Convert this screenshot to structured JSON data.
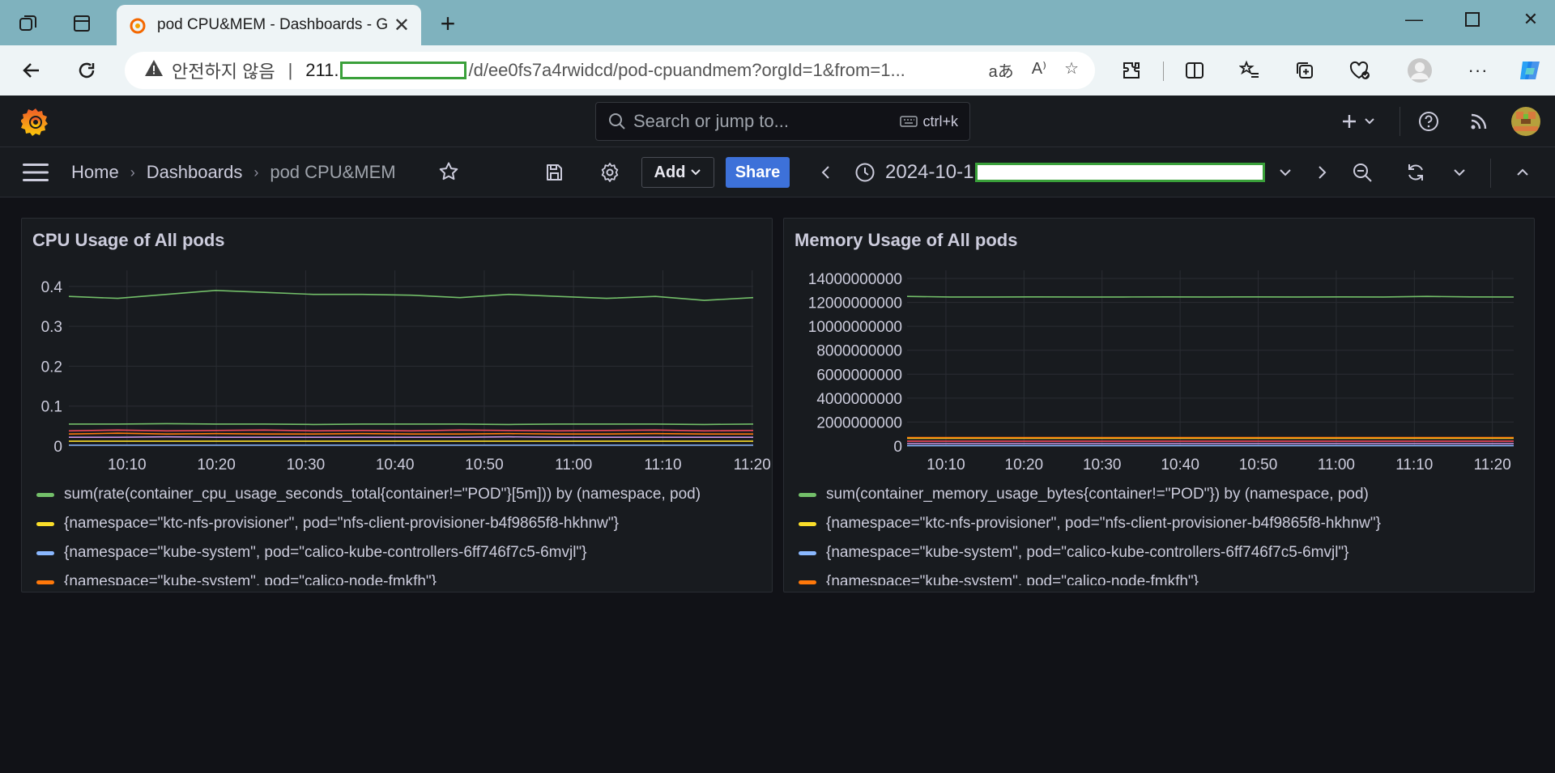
{
  "browser": {
    "tab_title": "pod CPU&MEM - Dashboards - G",
    "address_prefix_notsecure": "안전하지 않음",
    "address_host_prefix": "211.",
    "address_path": "/d/ee0fs7a4rwidcd/pod-cpuandmem?orgId=1&from=1...",
    "read_aloud_label": "aあ"
  },
  "grafana": {
    "search_placeholder": "Search or jump to...",
    "search_shortcut": "ctrl+k",
    "breadcrumbs": [
      "Home",
      "Dashboards",
      "pod CPU&MEM"
    ],
    "add_label": "Add",
    "share_label": "Share",
    "time_range_prefix": "2024-10-1"
  },
  "colors": {
    "green": "#73bf69",
    "yellow": "#fade2a",
    "blue": "#8ab8ff",
    "orange": "#ff780a",
    "red": "#f2495c",
    "purple": "#ca95e5"
  },
  "panels": [
    {
      "title": "CPU Usage of All pods",
      "legend": [
        {
          "color": "#73bf69",
          "text": "sum(rate(container_cpu_usage_seconds_total{container!=\"POD\"}[5m])) by (namespace, pod)"
        },
        {
          "color": "#fade2a",
          "text": "{namespace=\"ktc-nfs-provisioner\", pod=\"nfs-client-provisioner-b4f9865f8-hkhnw\"}"
        },
        {
          "color": "#8ab8ff",
          "text": "{namespace=\"kube-system\", pod=\"calico-kube-controllers-6ff746f7c5-6mvjl\"}"
        },
        {
          "color": "#ff780a",
          "text": "{namespace=\"kube-system\", pod=\"calico-node-fmkfh\"}"
        }
      ]
    },
    {
      "title": "Memory Usage of All pods",
      "legend": [
        {
          "color": "#73bf69",
          "text": "sum(container_memory_usage_bytes{container!=\"POD\"}) by (namespace, pod)"
        },
        {
          "color": "#fade2a",
          "text": "{namespace=\"ktc-nfs-provisioner\", pod=\"nfs-client-provisioner-b4f9865f8-hkhnw\"}"
        },
        {
          "color": "#8ab8ff",
          "text": "{namespace=\"kube-system\", pod=\"calico-kube-controllers-6ff746f7c5-6mvjl\"}"
        },
        {
          "color": "#ff780a",
          "text": "{namespace=\"kube-system\", pod=\"calico-node-fmkfh\"}"
        }
      ]
    }
  ],
  "chart_data": [
    {
      "type": "line",
      "title": "CPU Usage of All pods",
      "x": [
        "10:10",
        "10:20",
        "10:30",
        "10:40",
        "10:50",
        "11:00",
        "11:10",
        "11:20"
      ],
      "yticks": [
        "0",
        "0.1",
        "0.2",
        "0.3",
        "0.4"
      ],
      "ylim": [
        0,
        0.42
      ],
      "series": [
        {
          "name": "sum(rate(container_cpu_usage_seconds_total{container!=\"POD\"}[5m])) by (namespace, pod)",
          "color": "#73bf69",
          "values": [
            0.375,
            0.37,
            0.38,
            0.39,
            0.385,
            0.38,
            0.38,
            0.378,
            0.372,
            0.38,
            0.375,
            0.37,
            0.375,
            0.365,
            0.372
          ]
        },
        {
          "name": "{namespace=\"ktc-nfs-provisioner\", pod=\"nfs-client-provisioner-b4f9865f8-hkhnw\"}",
          "color": "#fade2a",
          "values": [
            0.012,
            0.012,
            0.012,
            0.012,
            0.012,
            0.012,
            0.012,
            0.012,
            0.012,
            0.012,
            0.012,
            0.012,
            0.012,
            0.012,
            0.012
          ]
        },
        {
          "name": "{namespace=\"kube-system\", pod=\"calico-kube-controllers-6ff746f7c5-6mvjl\"}",
          "color": "#8ab8ff",
          "values": [
            0.002,
            0.002,
            0.002,
            0.002,
            0.002,
            0.002,
            0.002,
            0.002,
            0.002,
            0.002,
            0.002,
            0.002,
            0.002,
            0.002,
            0.002
          ]
        },
        {
          "name": "{namespace=\"kube-system\", pod=\"calico-node-fmkfh\"}",
          "color": "#ff780a",
          "values": [
            0.03,
            0.032,
            0.03,
            0.031,
            0.03,
            0.03,
            0.031,
            0.03,
            0.03,
            0.031,
            0.03,
            0.03,
            0.031,
            0.03,
            0.03
          ]
        },
        {
          "color": "#73bf69",
          "values": [
            0.055,
            0.055,
            0.056,
            0.055,
            0.055,
            0.054,
            0.055,
            0.055,
            0.055,
            0.054,
            0.055,
            0.055,
            0.055,
            0.054,
            0.055
          ]
        },
        {
          "color": "#f2495c",
          "values": [
            0.038,
            0.04,
            0.038,
            0.039,
            0.04,
            0.038,
            0.039,
            0.038,
            0.04,
            0.039,
            0.038,
            0.039,
            0.04,
            0.038,
            0.039
          ]
        },
        {
          "color": "#ca95e5",
          "values": [
            0.022,
            0.022,
            0.023,
            0.022,
            0.022,
            0.022,
            0.022,
            0.022,
            0.022,
            0.023,
            0.022,
            0.022,
            0.022,
            0.022,
            0.022
          ]
        }
      ]
    },
    {
      "type": "line",
      "title": "Memory Usage of All pods",
      "x": [
        "10:10",
        "10:20",
        "10:30",
        "10:40",
        "10:50",
        "11:00",
        "11:10",
        "11:20"
      ],
      "yticks": [
        "0",
        "2000000000",
        "4000000000",
        "6000000000",
        "8000000000",
        "10000000000",
        "12000000000",
        "14000000000"
      ],
      "ylim": [
        0,
        14000000000
      ],
      "series": [
        {
          "name": "sum(container_memory_usage_bytes{container!=\"POD\"}) by (namespace, pod)",
          "color": "#73bf69",
          "values": [
            12500000000,
            12450000000,
            12450000000,
            12460000000,
            12450000000,
            12450000000,
            12460000000,
            12450000000,
            12460000000,
            12450000000,
            12460000000,
            12450000000,
            12500000000,
            12460000000,
            12450000000
          ]
        },
        {
          "name": "{namespace=\"ktc-nfs-provisioner\", pod=\"nfs-client-provisioner-b4f9865f8-hkhnw\"}",
          "color": "#fade2a",
          "values": [
            650000000,
            650000000,
            650000000,
            650000000,
            650000000,
            650000000,
            650000000,
            650000000,
            650000000,
            650000000,
            650000000,
            650000000,
            650000000,
            650000000,
            650000000
          ]
        },
        {
          "name": "{namespace=\"kube-system\", pod=\"calico-kube-controllers-6ff746f7c5-6mvjl\"}",
          "color": "#8ab8ff",
          "values": [
            30000000,
            30000000,
            30000000,
            30000000,
            30000000,
            30000000,
            30000000,
            30000000,
            30000000,
            30000000,
            30000000,
            30000000,
            30000000,
            30000000,
            30000000
          ]
        },
        {
          "name": "{namespace=\"kube-system\", pod=\"calico-node-fmkfh\"}",
          "color": "#ff780a",
          "values": [
            700000000,
            700000000,
            700000000,
            700000000,
            700000000,
            700000000,
            700000000,
            700000000,
            700000000,
            700000000,
            700000000,
            700000000,
            700000000,
            700000000,
            700000000
          ]
        },
        {
          "color": "#f2495c",
          "values": [
            400000000,
            400000000,
            400000000,
            400000000,
            400000000,
            400000000,
            400000000,
            400000000,
            400000000,
            400000000,
            400000000,
            400000000,
            400000000,
            400000000,
            400000000
          ]
        },
        {
          "color": "#ca95e5",
          "values": [
            200000000,
            200000000,
            200000000,
            200000000,
            200000000,
            200000000,
            200000000,
            200000000,
            200000000,
            200000000,
            200000000,
            200000000,
            200000000,
            200000000,
            200000000
          ]
        }
      ]
    }
  ]
}
